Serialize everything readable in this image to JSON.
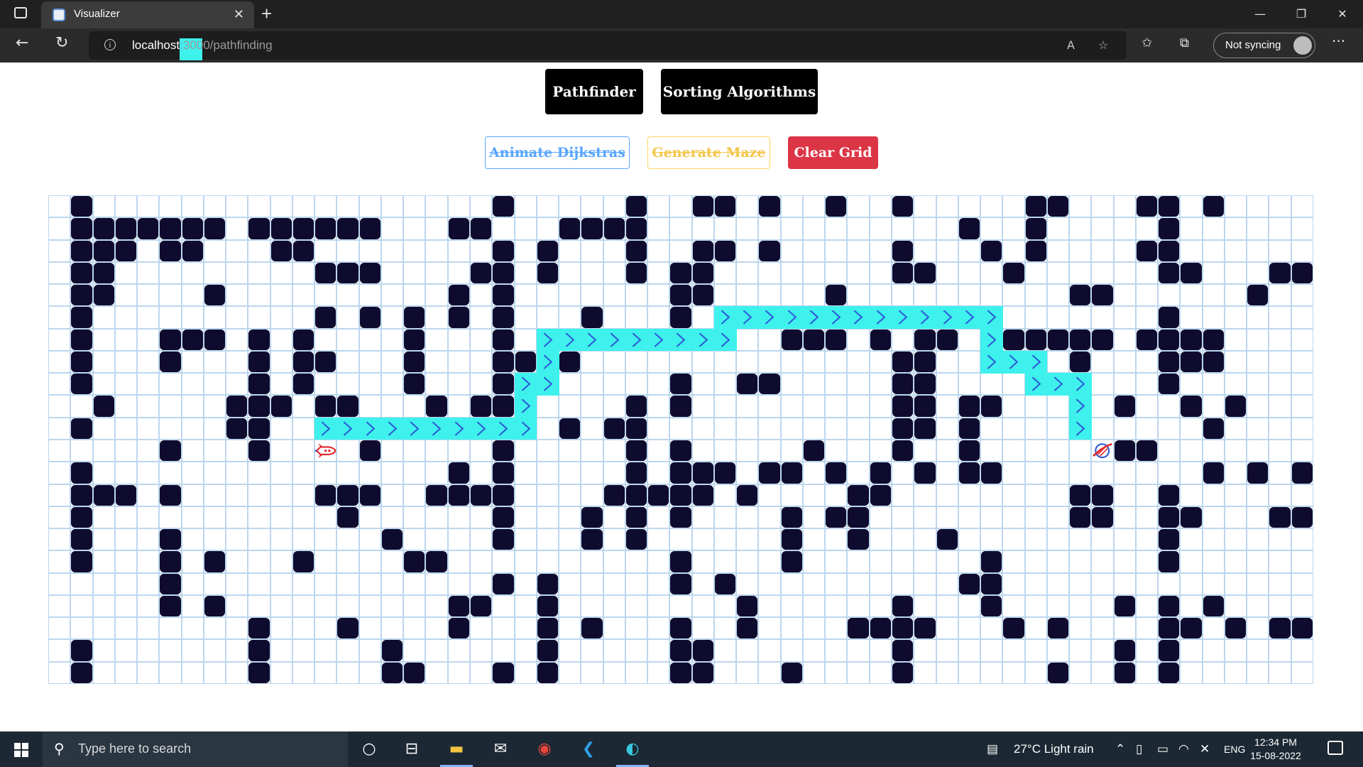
{
  "browser": {
    "tab_title": "Visualizer",
    "url_host": "localhost",
    "url_path": ":3000/pathfinding",
    "sync_label": "Not syncing"
  },
  "nav": {
    "pathfinder_label": "Pathfinder",
    "sorting_label": "Sorting Algorithms"
  },
  "actions": {
    "dijkstra_label": "Animate Dijkstras",
    "maze_label": "Generate Maze",
    "clear_label": "Clear Grid"
  },
  "grid": {
    "cols": 57,
    "rows": 22,
    "start": [
      12,
      11
    ],
    "finish": [
      47,
      11
    ],
    "walls": [
      [
        1,
        0
      ],
      [
        20,
        0
      ],
      [
        26,
        0
      ],
      [
        29,
        0
      ],
      [
        30,
        0
      ],
      [
        32,
        0
      ],
      [
        35,
        0
      ],
      [
        38,
        0
      ],
      [
        44,
        0
      ],
      [
        45,
        0
      ],
      [
        49,
        0
      ],
      [
        50,
        0
      ],
      [
        52,
        0
      ],
      [
        1,
        1
      ],
      [
        2,
        1
      ],
      [
        3,
        1
      ],
      [
        4,
        1
      ],
      [
        5,
        1
      ],
      [
        6,
        1
      ],
      [
        7,
        1
      ],
      [
        9,
        1
      ],
      [
        10,
        1
      ],
      [
        11,
        1
      ],
      [
        12,
        1
      ],
      [
        13,
        1
      ],
      [
        14,
        1
      ],
      [
        18,
        1
      ],
      [
        19,
        1
      ],
      [
        23,
        1
      ],
      [
        24,
        1
      ],
      [
        25,
        1
      ],
      [
        26,
        1
      ],
      [
        41,
        1
      ],
      [
        44,
        1
      ],
      [
        50,
        1
      ],
      [
        1,
        2
      ],
      [
        2,
        2
      ],
      [
        3,
        2
      ],
      [
        5,
        2
      ],
      [
        6,
        2
      ],
      [
        10,
        2
      ],
      [
        11,
        2
      ],
      [
        20,
        2
      ],
      [
        22,
        2
      ],
      [
        26,
        2
      ],
      [
        29,
        2
      ],
      [
        30,
        2
      ],
      [
        32,
        2
      ],
      [
        38,
        2
      ],
      [
        42,
        2
      ],
      [
        44,
        2
      ],
      [
        49,
        2
      ],
      [
        50,
        2
      ],
      [
        1,
        3
      ],
      [
        2,
        3
      ],
      [
        12,
        3
      ],
      [
        13,
        3
      ],
      [
        14,
        3
      ],
      [
        19,
        3
      ],
      [
        20,
        3
      ],
      [
        22,
        3
      ],
      [
        26,
        3
      ],
      [
        28,
        3
      ],
      [
        29,
        3
      ],
      [
        38,
        3
      ],
      [
        39,
        3
      ],
      [
        43,
        3
      ],
      [
        50,
        3
      ],
      [
        51,
        3
      ],
      [
        55,
        3
      ],
      [
        56,
        3
      ],
      [
        1,
        4
      ],
      [
        2,
        4
      ],
      [
        7,
        4
      ],
      [
        18,
        4
      ],
      [
        20,
        4
      ],
      [
        28,
        4
      ],
      [
        29,
        4
      ],
      [
        35,
        4
      ],
      [
        46,
        4
      ],
      [
        47,
        4
      ],
      [
        54,
        4
      ],
      [
        1,
        5
      ],
      [
        12,
        5
      ],
      [
        14,
        5
      ],
      [
        16,
        5
      ],
      [
        18,
        5
      ],
      [
        20,
        5
      ],
      [
        24,
        5
      ],
      [
        28,
        5
      ],
      [
        50,
        5
      ],
      [
        1,
        6
      ],
      [
        5,
        6
      ],
      [
        6,
        6
      ],
      [
        7,
        6
      ],
      [
        9,
        6
      ],
      [
        11,
        6
      ],
      [
        16,
        6
      ],
      [
        20,
        6
      ],
      [
        33,
        6
      ],
      [
        34,
        6
      ],
      [
        35,
        6
      ],
      [
        37,
        6
      ],
      [
        39,
        6
      ],
      [
        40,
        6
      ],
      [
        43,
        6
      ],
      [
        44,
        6
      ],
      [
        45,
        6
      ],
      [
        46,
        6
      ],
      [
        47,
        6
      ],
      [
        49,
        6
      ],
      [
        50,
        6
      ],
      [
        51,
        6
      ],
      [
        52,
        6
      ],
      [
        1,
        7
      ],
      [
        5,
        7
      ],
      [
        9,
        7
      ],
      [
        11,
        7
      ],
      [
        12,
        7
      ],
      [
        16,
        7
      ],
      [
        20,
        7
      ],
      [
        21,
        7
      ],
      [
        23,
        7
      ],
      [
        38,
        7
      ],
      [
        39,
        7
      ],
      [
        46,
        7
      ],
      [
        50,
        7
      ],
      [
        51,
        7
      ],
      [
        52,
        7
      ],
      [
        1,
        8
      ],
      [
        9,
        8
      ],
      [
        11,
        8
      ],
      [
        16,
        8
      ],
      [
        20,
        8
      ],
      [
        28,
        8
      ],
      [
        31,
        8
      ],
      [
        32,
        8
      ],
      [
        38,
        8
      ],
      [
        39,
        8
      ],
      [
        50,
        8
      ],
      [
        2,
        9
      ],
      [
        8,
        9
      ],
      [
        9,
        9
      ],
      [
        10,
        9
      ],
      [
        12,
        9
      ],
      [
        13,
        9
      ],
      [
        17,
        9
      ],
      [
        19,
        9
      ],
      [
        20,
        9
      ],
      [
        26,
        9
      ],
      [
        28,
        9
      ],
      [
        38,
        9
      ],
      [
        39,
        9
      ],
      [
        41,
        9
      ],
      [
        42,
        9
      ],
      [
        48,
        9
      ],
      [
        51,
        9
      ],
      [
        53,
        9
      ],
      [
        1,
        10
      ],
      [
        8,
        10
      ],
      [
        9,
        10
      ],
      [
        23,
        10
      ],
      [
        25,
        10
      ],
      [
        26,
        10
      ],
      [
        38,
        10
      ],
      [
        39,
        10
      ],
      [
        41,
        10
      ],
      [
        52,
        10
      ],
      [
        5,
        11
      ],
      [
        9,
        11
      ],
      [
        14,
        11
      ],
      [
        20,
        11
      ],
      [
        26,
        11
      ],
      [
        28,
        11
      ],
      [
        34,
        11
      ],
      [
        38,
        11
      ],
      [
        41,
        11
      ],
      [
        48,
        11
      ],
      [
        49,
        11
      ],
      [
        1,
        12
      ],
      [
        18,
        12
      ],
      [
        20,
        12
      ],
      [
        26,
        12
      ],
      [
        28,
        12
      ],
      [
        29,
        12
      ],
      [
        30,
        12
      ],
      [
        32,
        12
      ],
      [
        33,
        12
      ],
      [
        35,
        12
      ],
      [
        37,
        12
      ],
      [
        39,
        12
      ],
      [
        41,
        12
      ],
      [
        42,
        12
      ],
      [
        52,
        12
      ],
      [
        54,
        12
      ],
      [
        56,
        12
      ],
      [
        1,
        13
      ],
      [
        2,
        13
      ],
      [
        3,
        13
      ],
      [
        5,
        13
      ],
      [
        12,
        13
      ],
      [
        13,
        13
      ],
      [
        14,
        13
      ],
      [
        17,
        13
      ],
      [
        18,
        13
      ],
      [
        19,
        13
      ],
      [
        20,
        13
      ],
      [
        25,
        13
      ],
      [
        26,
        13
      ],
      [
        27,
        13
      ],
      [
        28,
        13
      ],
      [
        29,
        13
      ],
      [
        31,
        13
      ],
      [
        36,
        13
      ],
      [
        37,
        13
      ],
      [
        46,
        13
      ],
      [
        47,
        13
      ],
      [
        50,
        13
      ],
      [
        1,
        14
      ],
      [
        13,
        14
      ],
      [
        20,
        14
      ],
      [
        24,
        14
      ],
      [
        26,
        14
      ],
      [
        28,
        14
      ],
      [
        33,
        14
      ],
      [
        35,
        14
      ],
      [
        36,
        14
      ],
      [
        46,
        14
      ],
      [
        47,
        14
      ],
      [
        50,
        14
      ],
      [
        51,
        14
      ],
      [
        55,
        14
      ],
      [
        56,
        14
      ],
      [
        1,
        15
      ],
      [
        5,
        15
      ],
      [
        15,
        15
      ],
      [
        20,
        15
      ],
      [
        24,
        15
      ],
      [
        26,
        15
      ],
      [
        33,
        15
      ],
      [
        36,
        15
      ],
      [
        40,
        15
      ],
      [
        50,
        15
      ],
      [
        1,
        16
      ],
      [
        5,
        16
      ],
      [
        7,
        16
      ],
      [
        11,
        16
      ],
      [
        16,
        16
      ],
      [
        17,
        16
      ],
      [
        28,
        16
      ],
      [
        33,
        16
      ],
      [
        42,
        16
      ],
      [
        50,
        16
      ],
      [
        5,
        17
      ],
      [
        20,
        17
      ],
      [
        22,
        17
      ],
      [
        28,
        17
      ],
      [
        30,
        17
      ],
      [
        41,
        17
      ],
      [
        42,
        17
      ],
      [
        5,
        18
      ],
      [
        7,
        18
      ],
      [
        18,
        18
      ],
      [
        19,
        18
      ],
      [
        22,
        18
      ],
      [
        31,
        18
      ],
      [
        38,
        18
      ],
      [
        42,
        18
      ],
      [
        48,
        18
      ],
      [
        50,
        18
      ],
      [
        52,
        18
      ],
      [
        9,
        19
      ],
      [
        13,
        19
      ],
      [
        18,
        19
      ],
      [
        22,
        19
      ],
      [
        24,
        19
      ],
      [
        28,
        19
      ],
      [
        31,
        19
      ],
      [
        36,
        19
      ],
      [
        37,
        19
      ],
      [
        38,
        19
      ],
      [
        39,
        19
      ],
      [
        43,
        19
      ],
      [
        45,
        19
      ],
      [
        50,
        19
      ],
      [
        51,
        19
      ],
      [
        53,
        19
      ],
      [
        55,
        19
      ],
      [
        56,
        19
      ],
      [
        1,
        20
      ],
      [
        9,
        20
      ],
      [
        15,
        20
      ],
      [
        22,
        20
      ],
      [
        28,
        20
      ],
      [
        29,
        20
      ],
      [
        38,
        20
      ],
      [
        48,
        20
      ],
      [
        50,
        20
      ],
      [
        1,
        21
      ],
      [
        9,
        21
      ],
      [
        15,
        21
      ],
      [
        16,
        21
      ],
      [
        20,
        21
      ],
      [
        22,
        21
      ],
      [
        28,
        21
      ],
      [
        29,
        21
      ],
      [
        33,
        21
      ],
      [
        38,
        21
      ],
      [
        45,
        21
      ],
      [
        48,
        21
      ],
      [
        50,
        21
      ]
    ],
    "path": [
      [
        12,
        10
      ],
      [
        13,
        10
      ],
      [
        14,
        10
      ],
      [
        15,
        10
      ],
      [
        16,
        10
      ],
      [
        17,
        10
      ],
      [
        18,
        10
      ],
      [
        19,
        10
      ],
      [
        20,
        10
      ],
      [
        21,
        10
      ],
      [
        21,
        9
      ],
      [
        21,
        8
      ],
      [
        22,
        8
      ],
      [
        22,
        7
      ],
      [
        22,
        6
      ],
      [
        23,
        6
      ],
      [
        24,
        6
      ],
      [
        25,
        6
      ],
      [
        26,
        6
      ],
      [
        27,
        6
      ],
      [
        28,
        6
      ],
      [
        29,
        6
      ],
      [
        30,
        6
      ],
      [
        30,
        5
      ],
      [
        31,
        5
      ],
      [
        32,
        5
      ],
      [
        33,
        5
      ],
      [
        34,
        5
      ],
      [
        35,
        5
      ],
      [
        36,
        5
      ],
      [
        37,
        5
      ],
      [
        38,
        5
      ],
      [
        39,
        5
      ],
      [
        40,
        5
      ],
      [
        41,
        5
      ],
      [
        42,
        5
      ],
      [
        42,
        6
      ],
      [
        42,
        7
      ],
      [
        43,
        7
      ],
      [
        44,
        7
      ],
      [
        44,
        8
      ],
      [
        45,
        8
      ],
      [
        46,
        8
      ],
      [
        46,
        9
      ],
      [
        46,
        10
      ]
    ],
    "colors": {
      "wall": "#0f0b2e",
      "path": "#3ef1ec",
      "grid_line": "#bcd6ee",
      "chevron": "#2c5bd8"
    }
  },
  "taskbar": {
    "search_placeholder": "Type here to search",
    "weather": "27°C  Light rain",
    "language": "ENG",
    "time": "12:34 PM",
    "date": "15-08-2022"
  }
}
